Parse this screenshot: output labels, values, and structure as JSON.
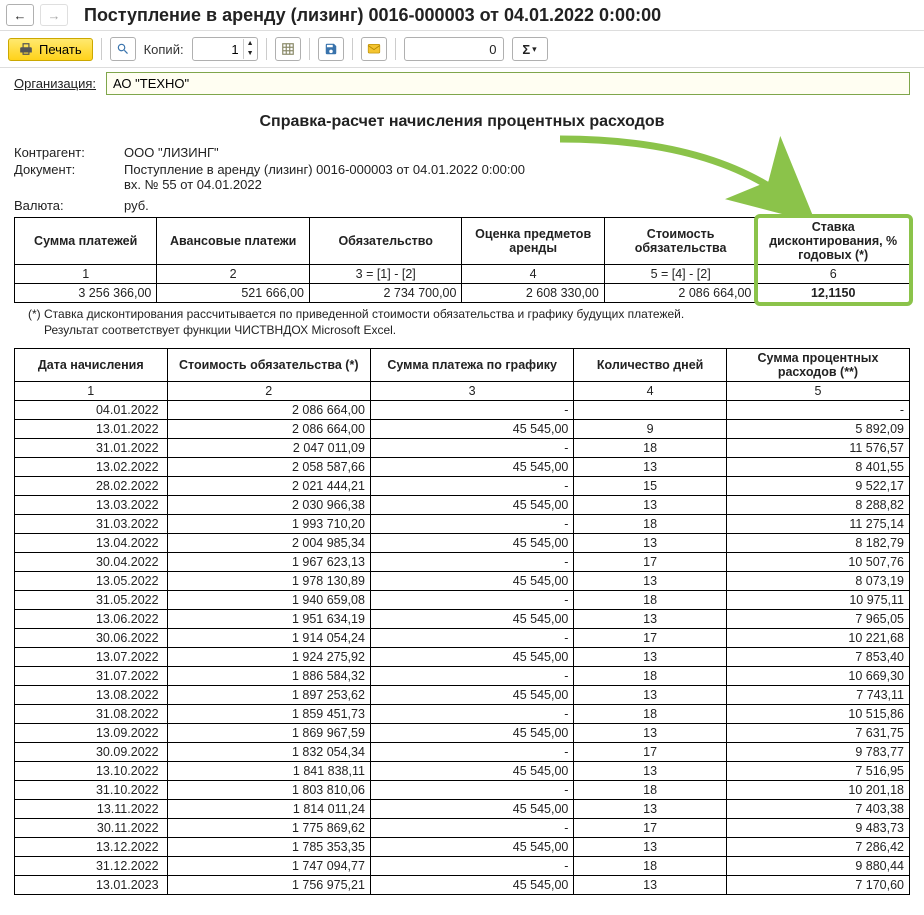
{
  "nav": {
    "title": "Поступление в аренду (лизинг) 0016-000003 от 04.01.2022 0:00:00"
  },
  "toolbar": {
    "print_label": "Печать",
    "copies_label": "Копий:",
    "copies_value": "1",
    "zero_value": "0"
  },
  "org": {
    "label": "Организация:",
    "value": "АО \"ТЕХНО\""
  },
  "report": {
    "title": "Справка-расчет начисления процентных расходов",
    "contractor_label": "Контрагент:",
    "contractor": "ООО \"ЛИЗИНГ\"",
    "document_label": "Документ:",
    "document_line1": "Поступление в аренду (лизинг) 0016-000003 от 04.01.2022 0:00:00",
    "document_line2": "вх. № 55 от 04.01.2022",
    "currency_label": "Валюта:",
    "currency": "руб.",
    "footnote_line1": "(*)  Ставка дисконтирования рассчитывается по приведенной стоимости обязательства и графику будущих платежей.",
    "footnote_line2": "Результат соответствует функции ЧИСТВНДОХ Microsoft Excel."
  },
  "summary": {
    "headers": [
      "Сумма платежей",
      "Авансовые платежи",
      "Обязательство",
      "Оценка предметов аренды",
      "Стоимость обязательства",
      "Ставка дисконтирования, % годовых (*)"
    ],
    "formula_row": [
      "1",
      "2",
      "3 = [1] - [2]",
      "4",
      "5 = [4] - [2]",
      "6"
    ],
    "data_row": [
      "3 256 366,00",
      "521 666,00",
      "2 734 700,00",
      "2 608 330,00",
      "2 086 664,00",
      "12,1150"
    ]
  },
  "detail": {
    "headers": [
      "Дата начисления",
      "Стоимость обязательства (*)",
      "Сумма платежа по графику",
      "Количество дней",
      "Сумма процентных расходов (**)"
    ],
    "num_row": [
      "1",
      "2",
      "3",
      "4",
      "5"
    ],
    "rows": [
      {
        "date": "04.01.2022",
        "cost": "2 086 664,00",
        "pay": "-",
        "days": "",
        "int": "-"
      },
      {
        "date": "13.01.2022",
        "cost": "2 086 664,00",
        "pay": "45 545,00",
        "days": "9",
        "int": "5 892,09"
      },
      {
        "date": "31.01.2022",
        "cost": "2 047 011,09",
        "pay": "-",
        "days": "18",
        "int": "11 576,57"
      },
      {
        "date": "13.02.2022",
        "cost": "2 058 587,66",
        "pay": "45 545,00",
        "days": "13",
        "int": "8 401,55"
      },
      {
        "date": "28.02.2022",
        "cost": "2 021 444,21",
        "pay": "-",
        "days": "15",
        "int": "9 522,17"
      },
      {
        "date": "13.03.2022",
        "cost": "2 030 966,38",
        "pay": "45 545,00",
        "days": "13",
        "int": "8 288,82"
      },
      {
        "date": "31.03.2022",
        "cost": "1 993 710,20",
        "pay": "-",
        "days": "18",
        "int": "11 275,14"
      },
      {
        "date": "13.04.2022",
        "cost": "2 004 985,34",
        "pay": "45 545,00",
        "days": "13",
        "int": "8 182,79"
      },
      {
        "date": "30.04.2022",
        "cost": "1 967 623,13",
        "pay": "-",
        "days": "17",
        "int": "10 507,76"
      },
      {
        "date": "13.05.2022",
        "cost": "1 978 130,89",
        "pay": "45 545,00",
        "days": "13",
        "int": "8 073,19"
      },
      {
        "date": "31.05.2022",
        "cost": "1 940 659,08",
        "pay": "-",
        "days": "18",
        "int": "10 975,11"
      },
      {
        "date": "13.06.2022",
        "cost": "1 951 634,19",
        "pay": "45 545,00",
        "days": "13",
        "int": "7 965,05"
      },
      {
        "date": "30.06.2022",
        "cost": "1 914 054,24",
        "pay": "-",
        "days": "17",
        "int": "10 221,68"
      },
      {
        "date": "13.07.2022",
        "cost": "1 924 275,92",
        "pay": "45 545,00",
        "days": "13",
        "int": "7 853,40"
      },
      {
        "date": "31.07.2022",
        "cost": "1 886 584,32",
        "pay": "-",
        "days": "18",
        "int": "10 669,30"
      },
      {
        "date": "13.08.2022",
        "cost": "1 897 253,62",
        "pay": "45 545,00",
        "days": "13",
        "int": "7 743,11"
      },
      {
        "date": "31.08.2022",
        "cost": "1 859 451,73",
        "pay": "-",
        "days": "18",
        "int": "10 515,86"
      },
      {
        "date": "13.09.2022",
        "cost": "1 869 967,59",
        "pay": "45 545,00",
        "days": "13",
        "int": "7 631,75"
      },
      {
        "date": "30.09.2022",
        "cost": "1 832 054,34",
        "pay": "-",
        "days": "17",
        "int": "9 783,77"
      },
      {
        "date": "13.10.2022",
        "cost": "1 841 838,11",
        "pay": "45 545,00",
        "days": "13",
        "int": "7 516,95"
      },
      {
        "date": "31.10.2022",
        "cost": "1 803 810,06",
        "pay": "-",
        "days": "18",
        "int": "10 201,18"
      },
      {
        "date": "13.11.2022",
        "cost": "1 814 011,24",
        "pay": "45 545,00",
        "days": "13",
        "int": "7 403,38"
      },
      {
        "date": "30.11.2022",
        "cost": "1 775 869,62",
        "pay": "-",
        "days": "17",
        "int": "9 483,73"
      },
      {
        "date": "13.12.2022",
        "cost": "1 785 353,35",
        "pay": "45 545,00",
        "days": "13",
        "int": "7 286,42"
      },
      {
        "date": "31.12.2022",
        "cost": "1 747 094,77",
        "pay": "-",
        "days": "18",
        "int": "9 880,44"
      },
      {
        "date": "13.01.2023",
        "cost": "1 756 975,21",
        "pay": "45 545,00",
        "days": "13",
        "int": "7 170,60"
      }
    ]
  }
}
